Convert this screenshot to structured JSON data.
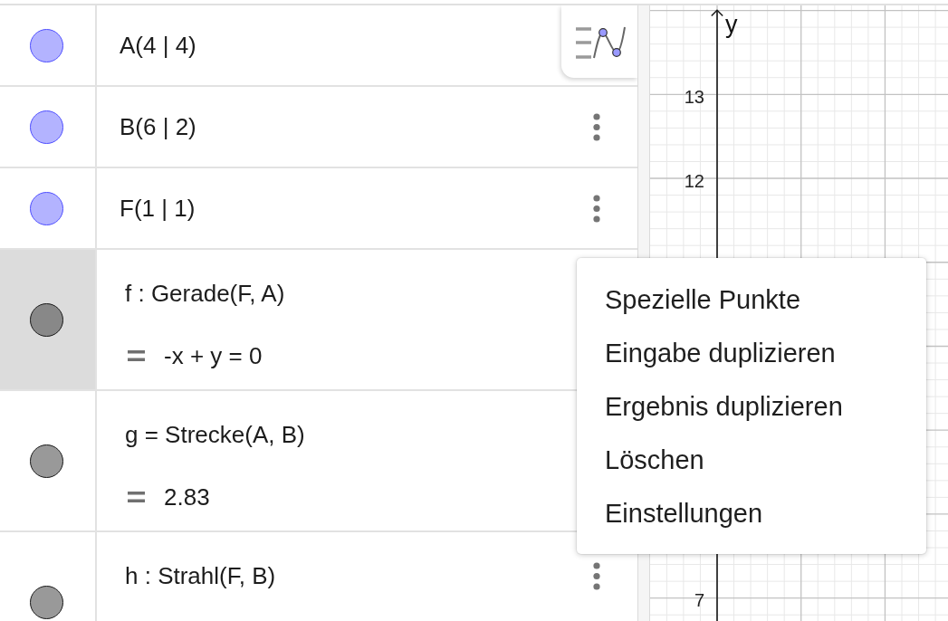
{
  "algebra_view": {
    "items": [
      {
        "kind": "point",
        "color": "#b3b3ff",
        "selected": false,
        "definition": "A(4 | 4)"
      },
      {
        "kind": "point",
        "color": "#b3b3ff",
        "selected": false,
        "definition": "B(6 | 2)"
      },
      {
        "kind": "point",
        "color": "#b3b3ff",
        "selected": false,
        "definition": "F(1 | 1)"
      },
      {
        "kind": "line",
        "color": "#888888",
        "selected": true,
        "definition": "f : Gerade(F, A)",
        "value": "-x + y = 0"
      },
      {
        "kind": "segment",
        "color": "#999999",
        "selected": false,
        "definition": "g = Strecke(A, B)",
        "value": "2.83"
      },
      {
        "kind": "ray",
        "color": "#999999",
        "selected": false,
        "definition": "h : Strahl(F, B)"
      }
    ]
  },
  "context_menu": {
    "items": [
      "Spezielle Punkte",
      "Eingabe duplizieren",
      "Ergebnis duplizieren",
      "Löschen",
      "Einstellungen"
    ]
  },
  "graphics_view": {
    "axis_label": "y",
    "tick_labels": [
      "13",
      "12",
      "7"
    ]
  }
}
